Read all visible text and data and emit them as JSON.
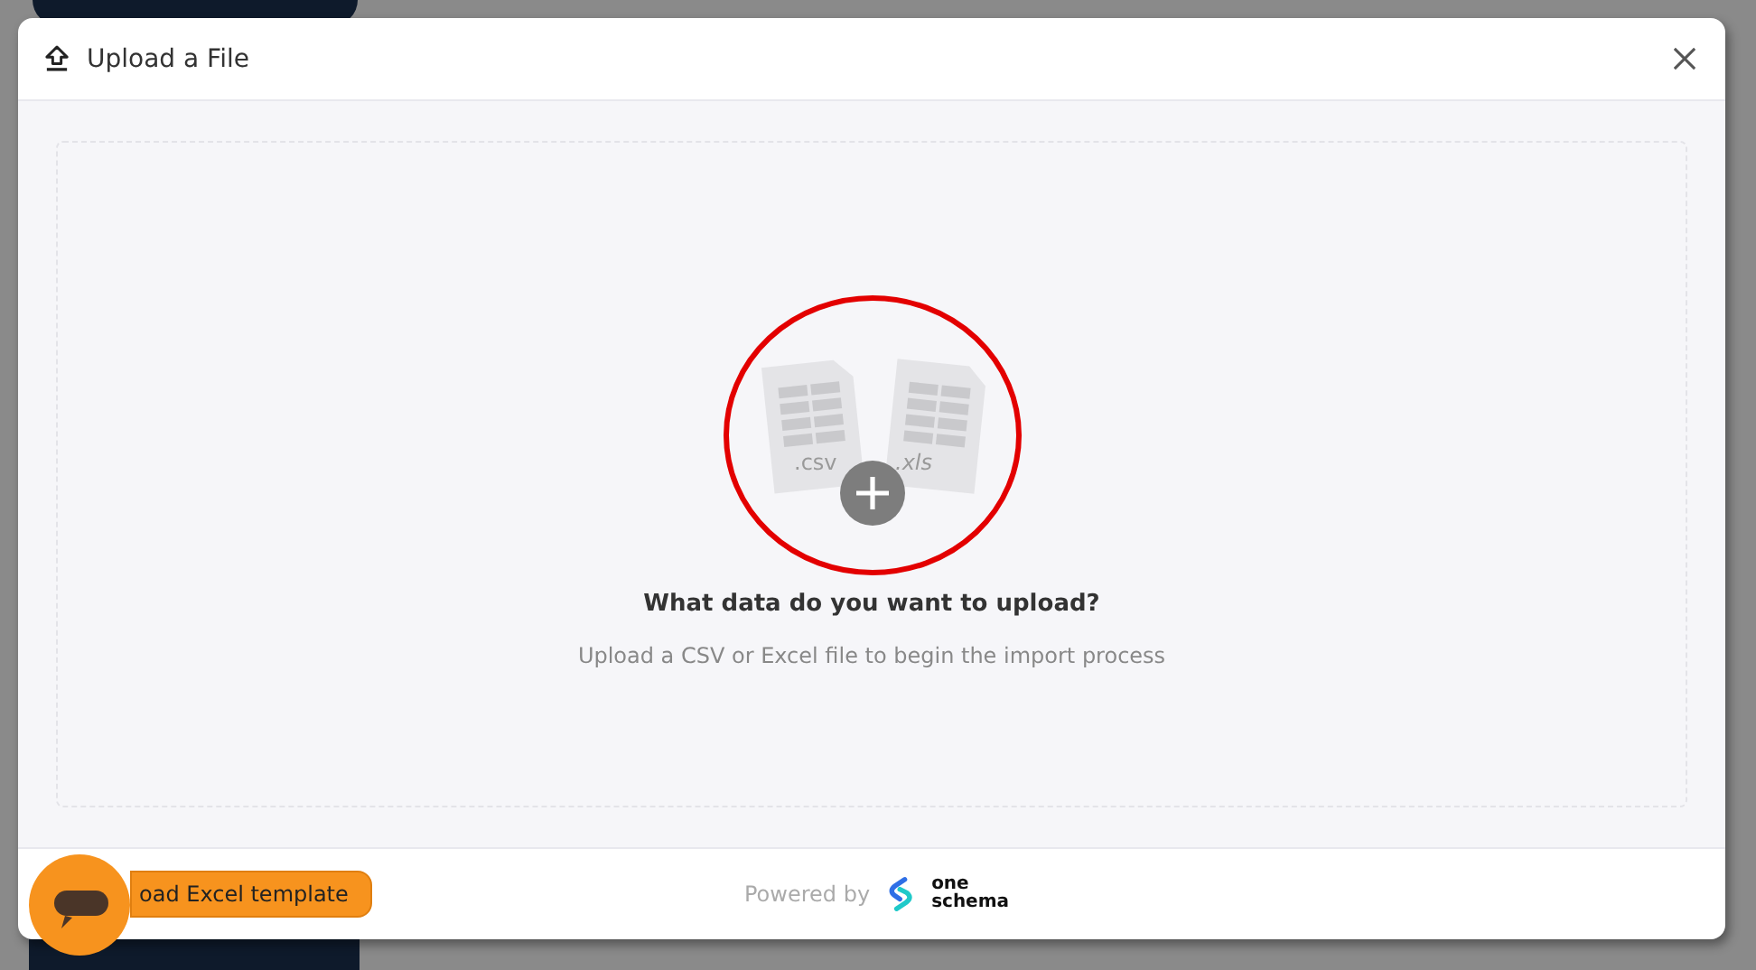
{
  "dialog": {
    "title": "Upload a File"
  },
  "dropzone": {
    "file_labels": [
      ".csv",
      ".xls"
    ],
    "heading": "What data do you want to upload?",
    "subtext": "Upload a CSV or Excel file to begin the import process"
  },
  "footer": {
    "template_button": "oad Excel template",
    "powered_by": "Powered by",
    "brand_lines": [
      "one",
      "schema"
    ]
  }
}
